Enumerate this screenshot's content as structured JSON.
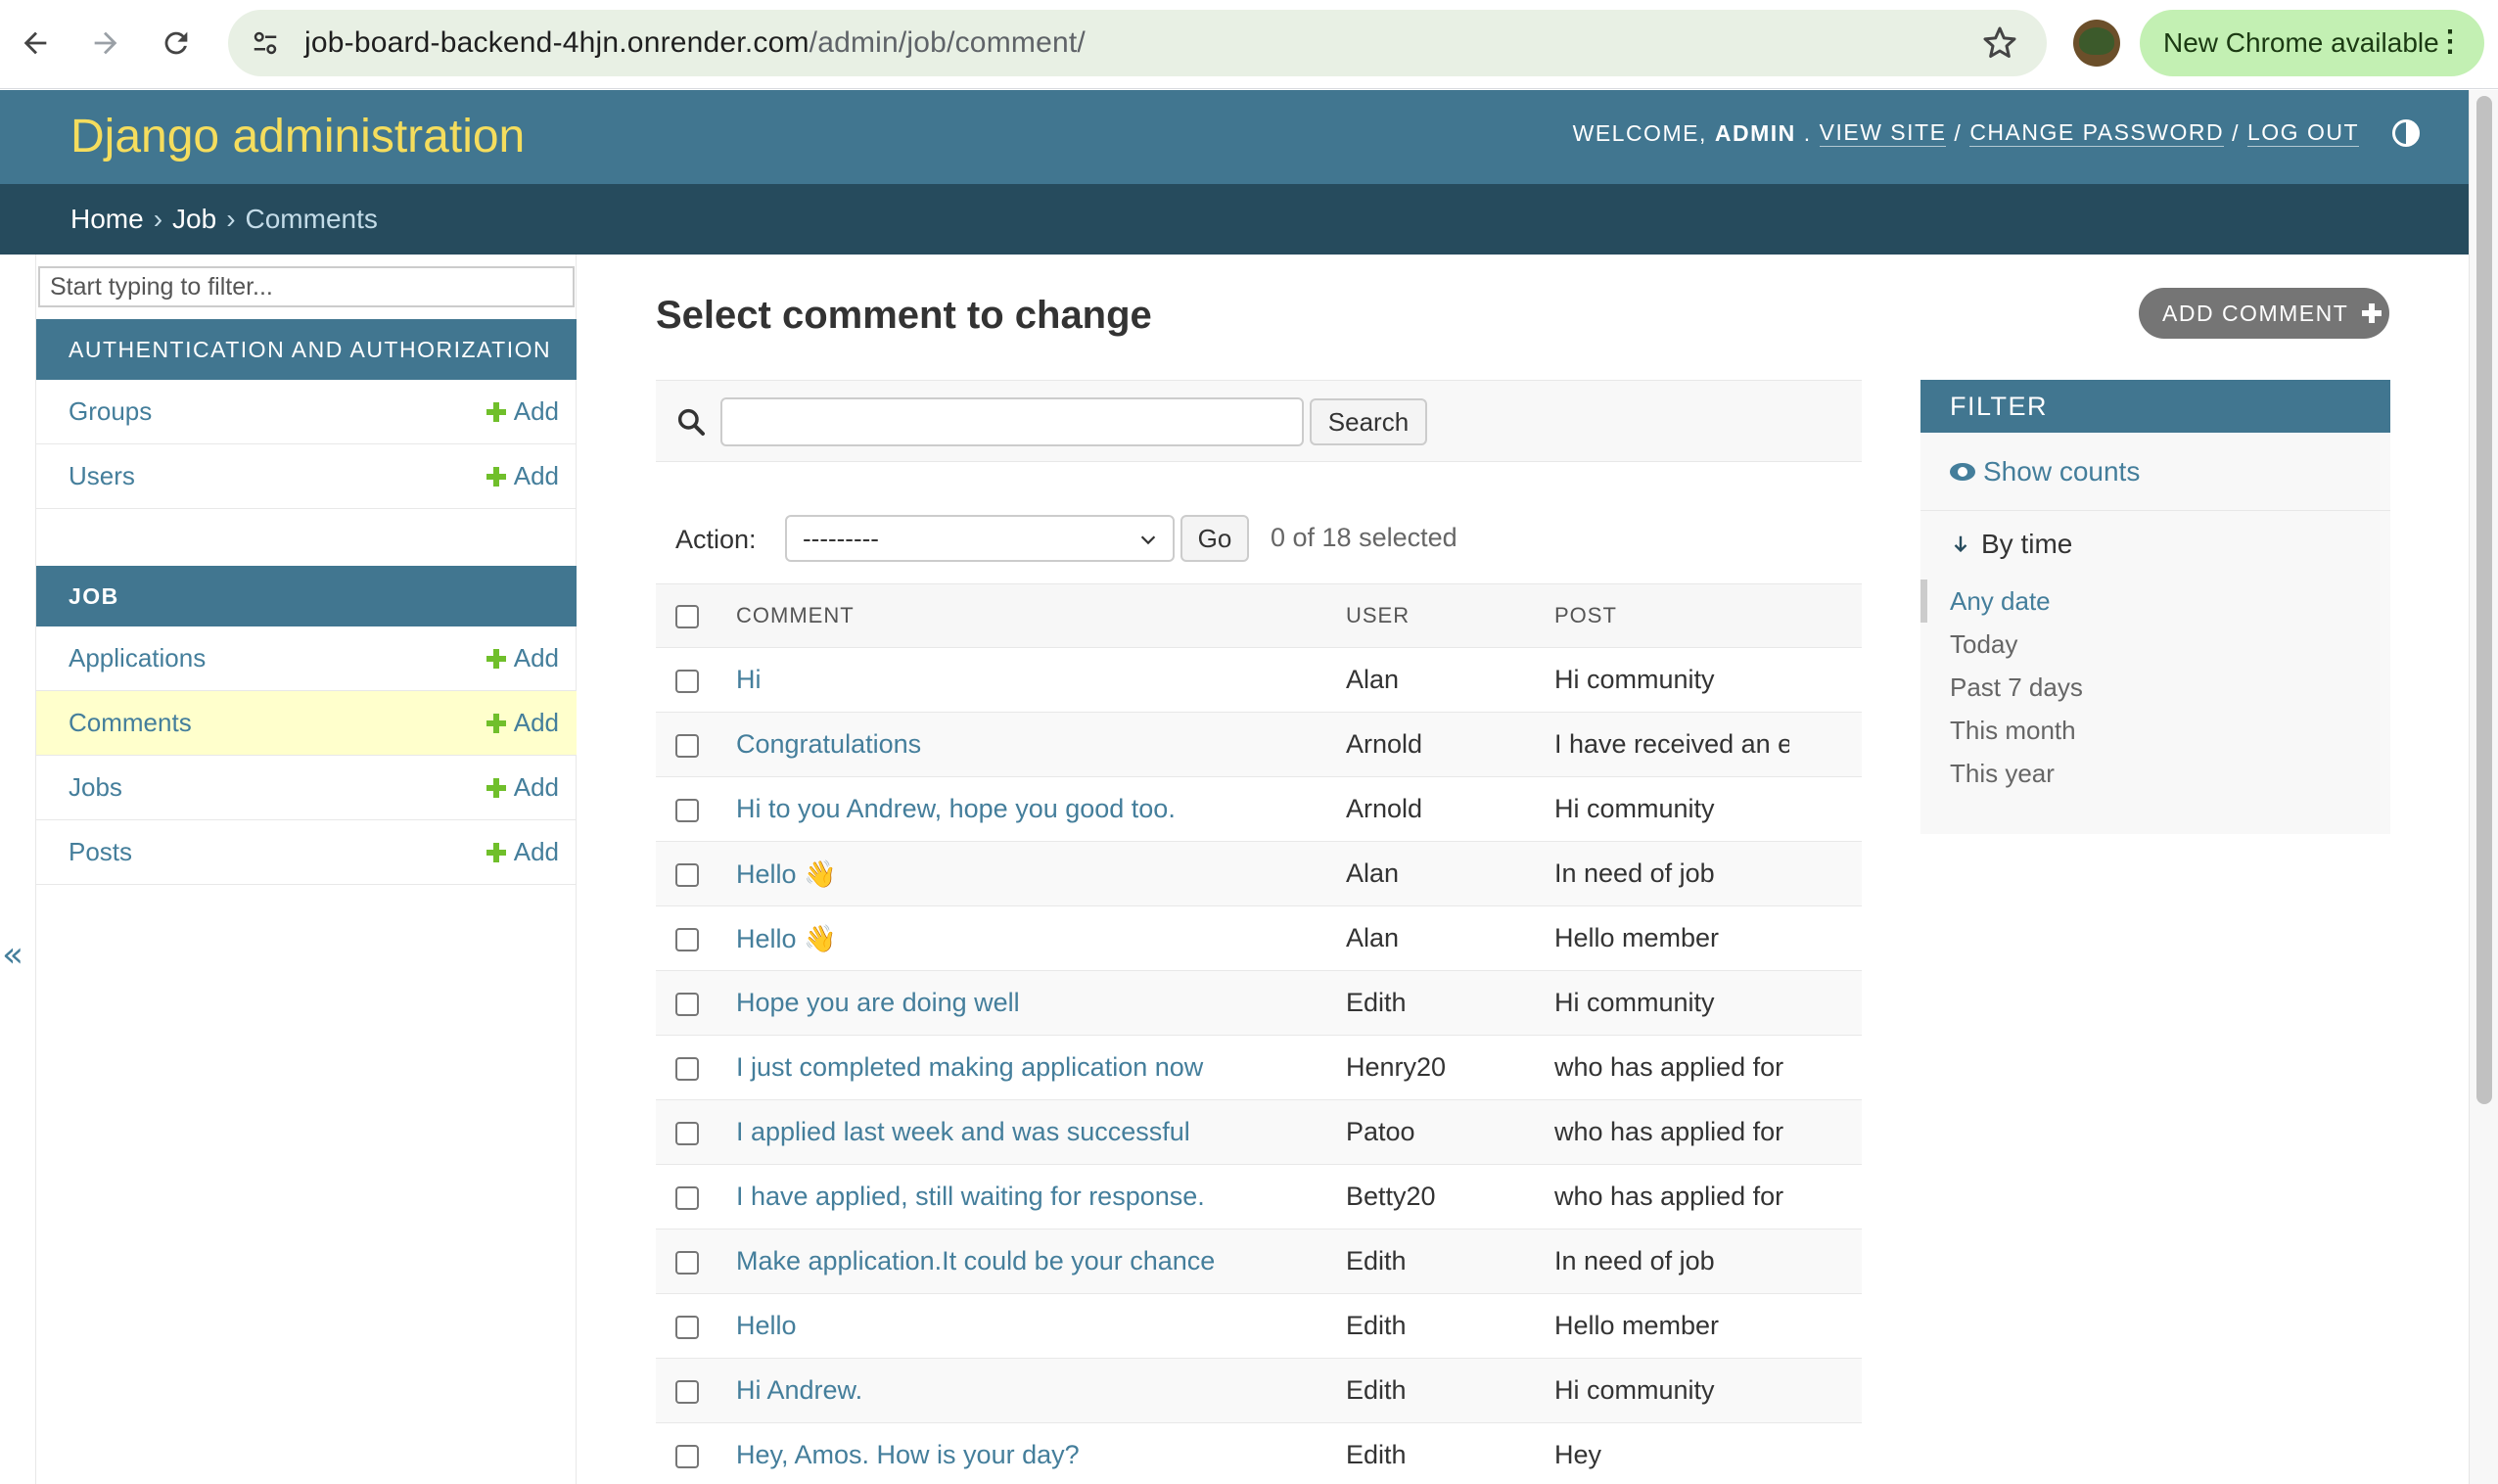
{
  "browser": {
    "url_host": "job-board-backend-4hjn.onrender.com",
    "url_path": "/admin/job/comment/",
    "update_label": "New Chrome available"
  },
  "header": {
    "branding": "Django administration",
    "welcome": "WELCOME,",
    "username": "ADMIN",
    "view_site": "VIEW SITE",
    "change_password": "CHANGE PASSWORD",
    "log_out": "LOG OUT"
  },
  "breadcrumbs": {
    "home": "Home",
    "app": "Job",
    "current": "Comments",
    "separator": "›"
  },
  "sidebar": {
    "filter_placeholder": "Start typing to filter...",
    "auth_caption": "AUTHENTICATION AND AUTHORIZATION",
    "auth_models": [
      {
        "name": "Groups",
        "add": "Add"
      },
      {
        "name": "Users",
        "add": "Add"
      }
    ],
    "job_caption": "JOB",
    "job_models": [
      {
        "name": "Applications",
        "add": "Add"
      },
      {
        "name": "Comments",
        "add": "Add"
      },
      {
        "name": "Jobs",
        "add": "Add"
      },
      {
        "name": "Posts",
        "add": "Add"
      }
    ],
    "collapse": "«"
  },
  "main": {
    "title": "Select comment to change",
    "add_button": "ADD COMMENT",
    "search_button": "Search",
    "action_label": "Action:",
    "action_value": "---------",
    "go_button": "Go",
    "selected_counter": "0 of 18 selected",
    "columns": [
      "COMMENT",
      "USER",
      "POST"
    ],
    "rows": [
      {
        "comment": "Hi",
        "user": "Alan",
        "post": "Hi community"
      },
      {
        "comment": "Congratulations",
        "user": "Arnold",
        "post": "I have received an e"
      },
      {
        "comment": "Hi to you Andrew, hope you good too.",
        "user": "Arnold",
        "post": "Hi community"
      },
      {
        "comment": "Hello 👋",
        "user": "Alan",
        "post": "In need of job"
      },
      {
        "comment": "Hello 👋",
        "user": "Alan",
        "post": "Hello member"
      },
      {
        "comment": "Hope you are doing well",
        "user": "Edith",
        "post": "Hi community"
      },
      {
        "comment": "I just completed making application now",
        "user": "Henry20",
        "post": "who has applied for"
      },
      {
        "comment": "I applied last week and was successful",
        "user": "Patoo",
        "post": "who has applied for"
      },
      {
        "comment": "I have applied, still waiting for response.",
        "user": "Betty20",
        "post": "who has applied for"
      },
      {
        "comment": "Make application.It could be your chance",
        "user": "Edith",
        "post": "In need of job"
      },
      {
        "comment": "Hello",
        "user": "Edith",
        "post": "Hello member"
      },
      {
        "comment": "Hi Andrew.",
        "user": "Edith",
        "post": "Hi community"
      },
      {
        "comment": "Hey, Amos. How is your day?",
        "user": "Edith",
        "post": "Hey"
      }
    ]
  },
  "filter": {
    "heading": "FILTER",
    "show_counts": "Show counts",
    "by_time": "By time",
    "options": [
      "Any date",
      "Today",
      "Past 7 days",
      "This month",
      "This year"
    ],
    "selected_index": 0
  },
  "colors": {
    "header_bg": "#417690",
    "breadcrumbs_bg": "#264b5d",
    "branding": "#f5dd5d",
    "link": "#447e9b",
    "add_green": "#70bf2b",
    "active_row": "#ffffcc"
  }
}
